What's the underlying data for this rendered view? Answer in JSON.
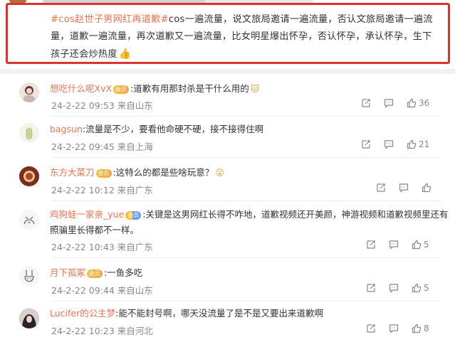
{
  "post": {
    "tag": "#cos赵世子男网红再道歉#",
    "text": "cos一遍流量，说文旅局邀请一遍流量，否认文旅局邀请一遍流量，道歉一遍流量，再次道歉又一遍流量，比女明星爆出怀孕，否认怀孕，承认怀孕，生下孩子还会炒热度"
  },
  "comments": [
    {
      "username": "想吃什么呢XvX",
      "badge": "vip",
      "badge_text": "会员",
      "text": ":道歉有用那封杀是干什么用的",
      "emoji": "🐱",
      "date": "24-2-22 09:53",
      "location": "来自山东",
      "likes": "36",
      "avatar_color": "#e9d9d2"
    },
    {
      "username": "bagsun",
      "badge": "",
      "badge_text": "",
      "text": ":流量是不少，要看他命硬不硬，接不接得住啊",
      "emoji": "",
      "date": "24-2-22 09:45",
      "location": "来自上海",
      "likes": "21",
      "avatar_color": "#eef0e2"
    },
    {
      "username": "东方大菜刀",
      "badge": "vip",
      "badge_text": "会员",
      "text": ":这特么的都是些啥玩意？",
      "emoji": "😮",
      "date": "24-2-22 10:12",
      "location": "来自广东",
      "likes": "",
      "avatar_color": "#7c2d1f"
    },
    {
      "username": "鸡狗蛙一家亲_yue",
      "badge": "vip",
      "badge_text": "会员",
      "text": ":关键是这男网红长得不咋地，道歉视频还开美颜，神游视频和道歉视频里还有照骗里长得都不一样。",
      "emoji": "",
      "date": "24-2-22 10:43",
      "location": "来自广东",
      "likes": "5",
      "avatar_color": "#f4f4f4"
    },
    {
      "username": "月下孤冢",
      "badge": "vip",
      "badge_text": "会员",
      "text": ":一鱼多吃",
      "emoji": "",
      "date": "24-2-22 09:44",
      "location": "来自山东",
      "likes": "5",
      "avatar_color": "#f4f4f4"
    },
    {
      "username": "Lucifer的公主梦",
      "badge": "",
      "badge_text": "",
      "text": ":能不能封号啊，哪天没流量了是不是又要出来道歉啊",
      "emoji": "",
      "date": "24-2-22 10:23",
      "location": "来自河北",
      "likes": "8",
      "avatar_color": "#3a3030"
    }
  ],
  "icons": {
    "share": "share-icon",
    "comment": "comment-icon",
    "like": "like-icon"
  },
  "colors": {
    "accent": "#eb7350",
    "highlight_border": "#d9342b",
    "meta": "#888888"
  }
}
